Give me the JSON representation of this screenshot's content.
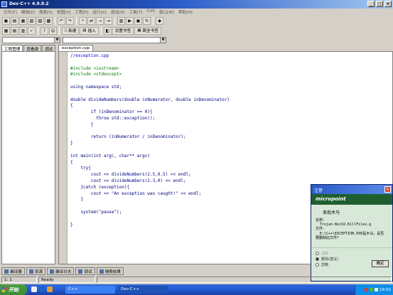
{
  "window": {
    "title": "Dev-C++ 4.9.9.2"
  },
  "menu": [
    "文件[F]",
    "编辑[E]",
    "搜索[S]",
    "视图[V]",
    "工程[P]",
    "运行[X]",
    "调试[D]",
    "工具[T]",
    "CVS",
    "窗口[W]",
    "帮助[H]"
  ],
  "toolbar": {
    "new_label": "新建",
    "insert_label": "插入",
    "set_bookmark_label": "设置书签",
    "goto_bookmark_label": "跳至书签"
  },
  "left_tabs": [
    "工程管理",
    "查看类",
    "调试"
  ],
  "editor": {
    "tab_label": "exception.cpp",
    "lines": [
      {
        "text": "//exception.cpp",
        "kind": "comment"
      },
      {
        "text": "",
        "kind": "normal"
      },
      {
        "text": "#include <iostream>",
        "kind": "pre"
      },
      {
        "text": "#include <stdexcept>",
        "kind": "pre"
      },
      {
        "text": "",
        "kind": "normal"
      },
      {
        "text": "using namespace std;",
        "kind": "kw"
      },
      {
        "text": "",
        "kind": "normal"
      },
      {
        "text": "double divideNumbers(double inNumerator, double inDenominator)",
        "kind": "normal"
      },
      {
        "text": "{",
        "kind": "normal"
      },
      {
        "text": "        if (inDenominator == 0){",
        "kind": "normal"
      },
      {
        "text": "          throw std::exception();",
        "kind": "normal"
      },
      {
        "text": "        }",
        "kind": "normal"
      },
      {
        "text": "",
        "kind": "normal"
      },
      {
        "text": "        return (inNumerator / inDenominator);",
        "kind": "normal"
      },
      {
        "text": "}",
        "kind": "normal"
      },
      {
        "text": "",
        "kind": "normal"
      },
      {
        "text": "int main(int argc, char** argv)",
        "kind": "normal"
      },
      {
        "text": "{",
        "kind": "normal"
      },
      {
        "text": "    try{",
        "kind": "normal"
      },
      {
        "text": "        cout << divideNumbers(2.5,0.5) << endl;",
        "kind": "normal"
      },
      {
        "text": "        cout << divideNumbers(2.3,0) << endl;",
        "kind": "normal"
      },
      {
        "text": "    }catch (exception){",
        "kind": "normal"
      },
      {
        "text": "        cout << \"An exception was caught!\" << endl;",
        "kind": "normal"
      },
      {
        "text": "    }",
        "kind": "normal"
      },
      {
        "text": "",
        "kind": "normal"
      },
      {
        "text": "    system(\"pause\");",
        "kind": "normal"
      },
      {
        "text": "",
        "kind": "normal"
      },
      {
        "text": "}",
        "kind": "normal"
      }
    ]
  },
  "dialog": {
    "title": "注意",
    "logo": "micropoint",
    "heading": "发现木马",
    "body": "名称：\n  Trojan.Win32.KillFiles.g\n文件：\n  E:\\C++\\EXCEPTION.EXE是木马，是否\n要删除此文件？",
    "options": [
      "清除",
      "删除(建议)",
      "忽略"
    ],
    "selected_option": "删除(建议)",
    "ok_label": "确定"
  },
  "bottom_tabs": [
    "编译器",
    "资源",
    "编译日志",
    "调试",
    "搜索结果"
  ],
  "status": {
    "position": "1: 1",
    "state": "Ready"
  },
  "taskbar": {
    "start_label": "开始",
    "tasks": [
      {
        "label": "C++",
        "active": false
      },
      {
        "label": "Dev-C++",
        "active": true
      }
    ],
    "clock": "19:02"
  }
}
